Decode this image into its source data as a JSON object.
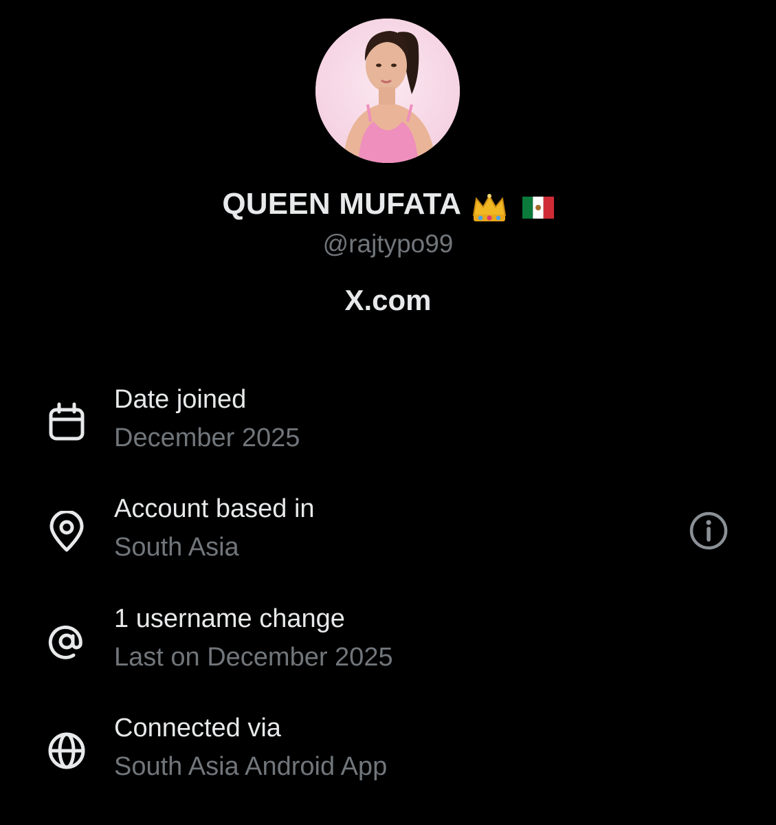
{
  "profile": {
    "display_name": "QUEEN MUFATA",
    "handle": "@rajtypo99",
    "site": "X.com"
  },
  "rows": [
    {
      "icon": "calendar-icon",
      "title": "Date joined",
      "value": "December 2025"
    },
    {
      "icon": "location-pin-icon",
      "title": "Account based in",
      "value": "South Asia"
    },
    {
      "icon": "at-sign-icon",
      "title": "1 username change",
      "value": "Last on December 2025"
    },
    {
      "icon": "globe-icon",
      "title": "Connected via",
      "value": "South Asia Android App"
    }
  ],
  "colors": {
    "background": "#000000",
    "primary_text": "#e7e9ea",
    "secondary_text": "#71767b",
    "avatar_bg": "#f7dce8"
  }
}
